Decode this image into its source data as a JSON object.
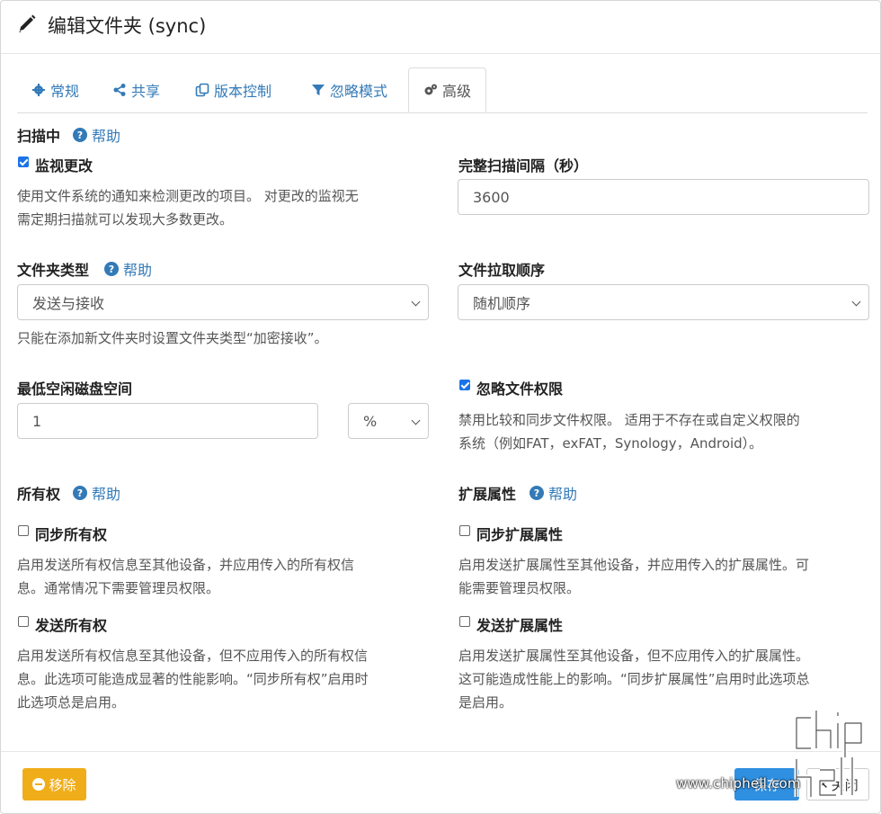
{
  "header": {
    "title": "编辑文件夹 (sync)",
    "icon": "pencil-icon"
  },
  "tabs": [
    {
      "label": "常规",
      "icon": "gear-icon",
      "active": false
    },
    {
      "label": "共享",
      "icon": "share-icon",
      "active": false
    },
    {
      "label": "版本控制",
      "icon": "copy-icon",
      "active": false
    },
    {
      "label": "忽略模式",
      "icon": "filter-icon",
      "active": false
    },
    {
      "label": "高级",
      "icon": "gears-icon",
      "active": true
    }
  ],
  "help_label": "帮助",
  "scanning": {
    "heading": "扫描中",
    "watch": {
      "label": "监视更改",
      "checked": true,
      "desc_line1": "使用文件系统的通知来检测更改的项目。 对更改的监视无",
      "desc_line2": "需定期扫描就可以发现大多数更改。"
    },
    "rescan": {
      "label": "完整扫描间隔（秒）",
      "value": "3600"
    }
  },
  "folder_type": {
    "label": "文件夹类型",
    "value": "发送与接收",
    "note": "只能在添加新文件夹时设置文件夹类型“加密接收”。"
  },
  "pull_order": {
    "label": "文件拉取顺序",
    "value": "随机顺序"
  },
  "min_disk": {
    "label": "最低空闲磁盘空间",
    "value": "1",
    "unit": "%"
  },
  "ignore_perms": {
    "label": "忽略文件权限",
    "checked": true,
    "desc_line1": "禁用比较和同步文件权限。 适用于不存在或自定义权限的",
    "desc_line2": "系统（例如FAT，exFAT，Synology，Android）。"
  },
  "ownership": {
    "heading": "所有权",
    "sync": {
      "label": "同步所有权",
      "checked": false,
      "desc_line1": "启用发送所有权信息至其他设备，并应用传入的所有权信",
      "desc_line2": "息。通常情况下需要管理员权限。"
    },
    "send": {
      "label": "发送所有权",
      "checked": false,
      "desc_line1": "启用发送所有权信息至其他设备，但不应用传入的所有权信",
      "desc_line2": "息。此选项可能造成显著的性能影响。“同步所有权”启用时",
      "desc_line3": "此选项总是启用。"
    }
  },
  "xattrs": {
    "heading": "扩展属性",
    "sync": {
      "label": "同步扩展属性",
      "checked": false,
      "desc_line1": "启用发送扩展属性至其他设备，并应用传入的扩展属性。可",
      "desc_line2": "能需要管理员权限。"
    },
    "send": {
      "label": "发送扩展属性",
      "checked": false,
      "desc_line1": "启用发送扩展属性至其他设备，但不应用传入的扩展属性。",
      "desc_line2": "这可能造成性能上的影响。“同步扩展属性”启用时此选项总",
      "desc_line3": "是启用。"
    }
  },
  "footer": {
    "remove": "移除",
    "save": "保存",
    "close": "关闭"
  },
  "watermark": {
    "text": "www.chiphell.com",
    "logo": "chip hell"
  },
  "colors": {
    "link": "#337ab7",
    "warning": "#f0ad1a",
    "primary": "#2f8fe0"
  }
}
